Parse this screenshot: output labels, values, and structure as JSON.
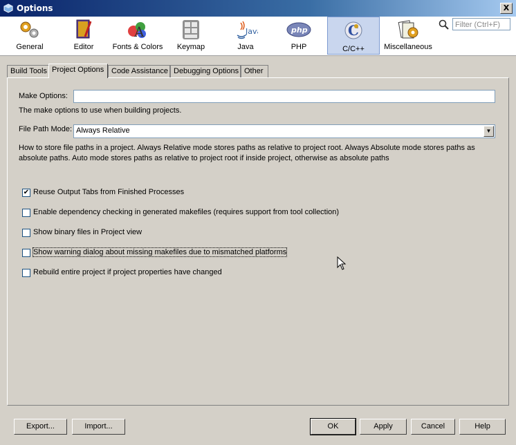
{
  "window": {
    "title": "Options",
    "close_glyph": "X"
  },
  "categories": [
    {
      "label": "General",
      "icon": "gears-icon"
    },
    {
      "label": "Editor",
      "icon": "editor-book-icon"
    },
    {
      "label": "Fonts & Colors",
      "icon": "fonts-colors-icon"
    },
    {
      "label": "Keymap",
      "icon": "keyboard-icon"
    },
    {
      "label": "Java",
      "icon": "java-icon"
    },
    {
      "label": "PHP",
      "icon": "php-icon"
    },
    {
      "label": "C/C++",
      "icon": "cpp-icon",
      "selected": true
    },
    {
      "label": "Miscellaneous",
      "icon": "misc-icon"
    }
  ],
  "search": {
    "placeholder": "Filter (Ctrl+F)"
  },
  "tabs": [
    {
      "label": "Build Tools"
    },
    {
      "label": "Project Options",
      "active": true
    },
    {
      "label": "Code Assistance"
    },
    {
      "label": "Debugging Options"
    },
    {
      "label": "Other"
    }
  ],
  "make_options": {
    "label": "Make Options:",
    "value": "",
    "help": "The make options to use when building projects."
  },
  "file_path_mode": {
    "label": "File Path Mode:",
    "value": "Always Relative",
    "help_line1": "How to store file paths in a project. Always Relative mode stores paths as relative to project root. Always Absolute mode stores paths as",
    "help_line2": "absolute paths. Auto mode stores paths as relative to project root if inside project, otherwise as absolute paths"
  },
  "checkboxes": [
    {
      "label": "Reuse Output Tabs from Finished Processes",
      "checked": true
    },
    {
      "label": "Enable dependency checking in generated makefiles (requires support from tool collection)",
      "checked": false
    },
    {
      "label": "Show binary files in Project view",
      "checked": false
    },
    {
      "label": "Show warning dialog about missing makefiles due to mismatched platforms",
      "checked": false
    },
    {
      "label": "Rebuild entire project if project properties have changed",
      "checked": false
    }
  ],
  "buttons": {
    "export": "Export...",
    "import": "Import...",
    "ok": "OK",
    "apply": "Apply",
    "cancel": "Cancel",
    "help": "Help"
  },
  "colors": {
    "selection": "#c9d6ee",
    "dialog_bg": "#d4d0c8"
  }
}
